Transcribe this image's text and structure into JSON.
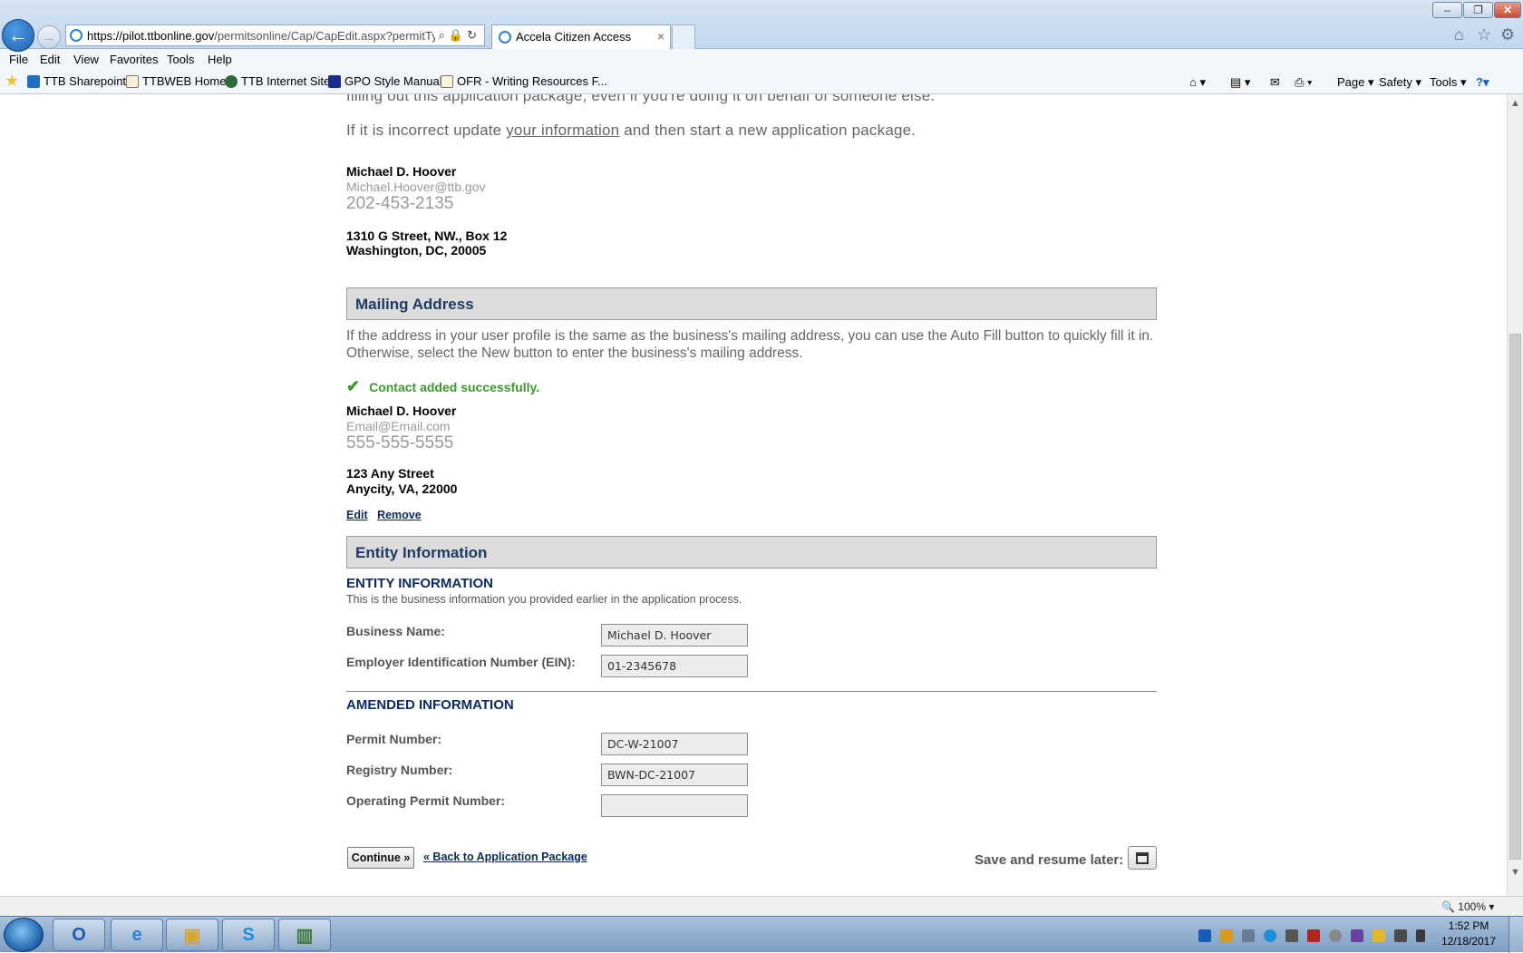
{
  "browser": {
    "url_host": "https://pilot.ttbonline.gov",
    "url_rest": "/permitsonline/Cap/CapEdit.aspx?permitTyp",
    "tab_title": "Accela Citizen Access",
    "tab_close": "×",
    "menu": [
      "File",
      "Edit",
      "View",
      "Favorites",
      "Tools",
      "Help"
    ],
    "favorites": [
      "TTB Sharepoint",
      "TTBWEB Home",
      "TTB Internet Site",
      "GPO Style Manual",
      "OFR - Writing Resources F..."
    ],
    "commands": [
      "Page ▾",
      "Safety ▾",
      "Tools ▾"
    ],
    "zoom": "100%"
  },
  "applicant": {
    "intro_line1": "filling out this application package, even if you're doing it on behalf of someone else.",
    "intro_line2_pre": "If it is incorrect update ",
    "intro_line2_link": "your information",
    "intro_line2_post": " and then start a new application package.",
    "name": "Michael D. Hoover",
    "email": "Michael.Hoover@ttb.gov",
    "phone": "202-453-2135",
    "address_line1": "1310 G Street, NW., Box 12",
    "address_line2": "Washington, DC, 20005"
  },
  "mailing": {
    "header": "Mailing Address",
    "description": "If the address in your user profile is the same as the business's mailing address, you can use the Auto Fill button to quickly fill it in. Otherwise, select the New button to enter the business's mailing address.",
    "success_message": "Contact added successfully.",
    "name": "Michael D. Hoover",
    "email": "Email@Email.com",
    "phone": "555-555-5555",
    "address_line1": "123 Any Street",
    "address_line2": "Anycity, VA, 22000",
    "edit_label": "Edit",
    "remove_label": "Remove"
  },
  "entity": {
    "header": "Entity Information",
    "subtitle": "ENTITY INFORMATION",
    "description": "This is the business information you provided earlier in the application process.",
    "business_name_label": "Business Name:",
    "business_name_value": "Michael D. Hoover",
    "ein_label": "Employer Identification Number (EIN):",
    "ein_value": "01-2345678"
  },
  "amended": {
    "subtitle": "AMENDED INFORMATION",
    "permit_label": "Permit Number:",
    "permit_value": "DC-W-21007",
    "registry_label": "Registry Number:",
    "registry_value": "BWN-DC-21007",
    "operating_label": "Operating Permit Number:",
    "operating_value": ""
  },
  "actions": {
    "continue_label": "Continue »",
    "back_label": "« Back to Application Package",
    "save_label": "Save and resume later:"
  },
  "taskbar": {
    "time": "1:52 PM",
    "date": "12/18/2017"
  }
}
